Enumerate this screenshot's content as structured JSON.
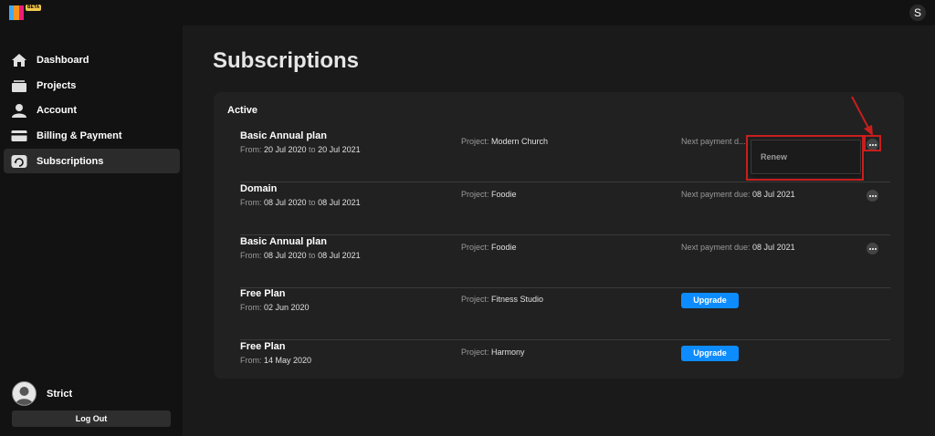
{
  "app": {
    "beta_badge": "BETA",
    "user_initial": "S"
  },
  "sidebar": {
    "items": [
      {
        "label": "Dashboard",
        "icon": "home-icon"
      },
      {
        "label": "Projects",
        "icon": "projects-icon"
      },
      {
        "label": "Account",
        "icon": "account-icon"
      },
      {
        "label": "Billing & Payment",
        "icon": "credit-card-icon"
      },
      {
        "label": "Subscriptions",
        "icon": "subscriptions-icon",
        "active": true
      }
    ],
    "user_name": "Strict",
    "logout_label": "Log Out"
  },
  "page": {
    "title": "Subscriptions",
    "section": "Active"
  },
  "labels": {
    "from": "From: ",
    "to": " to ",
    "project": "Project: ",
    "next_payment": "Next payment due: ",
    "next_payment_truncated": "Next payment d..."
  },
  "subscriptions": [
    {
      "name": "Basic Annual plan",
      "from": "20 Jul 2020",
      "to": "20 Jul 2021",
      "project": "Modern Church",
      "next_payment": ""
    },
    {
      "name": "Domain",
      "from": "08 Jul 2020",
      "to": "08 Jul 2021",
      "project": "Foodie",
      "next_payment": "08 Jul 2021"
    },
    {
      "name": "Basic Annual plan",
      "from": "08 Jul 2020",
      "to": "08 Jul 2021",
      "project": "Foodie",
      "next_payment": "08 Jul 2021"
    },
    {
      "name": "Free Plan",
      "from": "02 Jun 2020",
      "to": "",
      "project": "Fitness Studio",
      "action": "Upgrade"
    },
    {
      "name": "Free Plan",
      "from": "14 May 2020",
      "to": "",
      "project": "Harmony",
      "action": "Upgrade"
    }
  ],
  "dropdown": {
    "items": [
      "Renew"
    ]
  },
  "colors": {
    "accent": "#0d8cff",
    "highlight": "#c81e1e",
    "background": "#1a1a1a",
    "sidebar": "#121212",
    "card": "#212121"
  }
}
